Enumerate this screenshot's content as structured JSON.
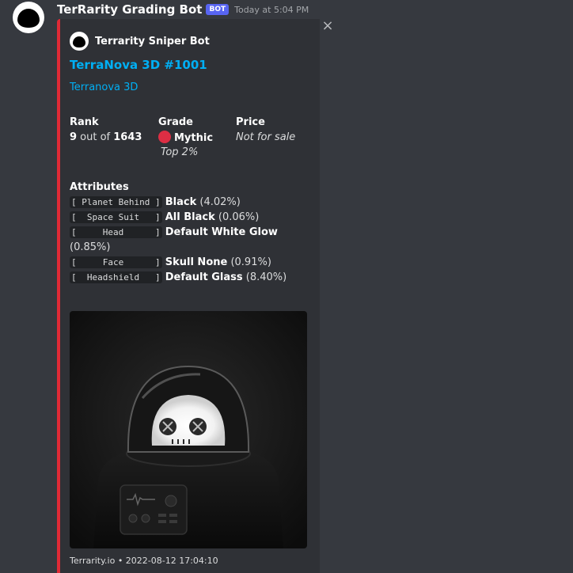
{
  "message": {
    "username": "TerRarity Grading Bot",
    "bot_tag": "BOT",
    "timestamp": "Today at 5:04 PM"
  },
  "embed": {
    "accent_color": "#e02a36",
    "close_icon": "×",
    "author": "Terrarity Sniper Bot",
    "title": "TerraNova 3D #1001",
    "description": "Terranova 3D",
    "fields": {
      "rank": {
        "name": "Rank",
        "value_num": "9",
        "value_mid": " out of ",
        "value_total": "1643"
      },
      "grade": {
        "name": "Grade",
        "icon": "red-circle-icon",
        "value": "Mythic",
        "subvalue": "Top 2%"
      },
      "price": {
        "name": "Price",
        "value": "Not for sale"
      }
    },
    "attributes": {
      "name": "Attributes",
      "items": [
        {
          "key": "[ Planet Behind ]",
          "value": "Black",
          "pct": " (4.02%)"
        },
        {
          "key": "[  Space Suit   ]",
          "value": "All Black",
          "pct": " (0.06%)"
        },
        {
          "key": "[     Head      ]",
          "value": "Default White Glow",
          "pct": " (0.85%)"
        },
        {
          "key": "[     Face      ]",
          "value": "Skull None",
          "pct": " (0.91%)"
        },
        {
          "key": "[  Headshield   ]",
          "value": "Default Glass",
          "pct": " (8.40%)"
        }
      ]
    },
    "image": {
      "subject": "astronaut-skull-render"
    },
    "footer": "Terrarity.io • 2022-08-12 17:04:10"
  }
}
